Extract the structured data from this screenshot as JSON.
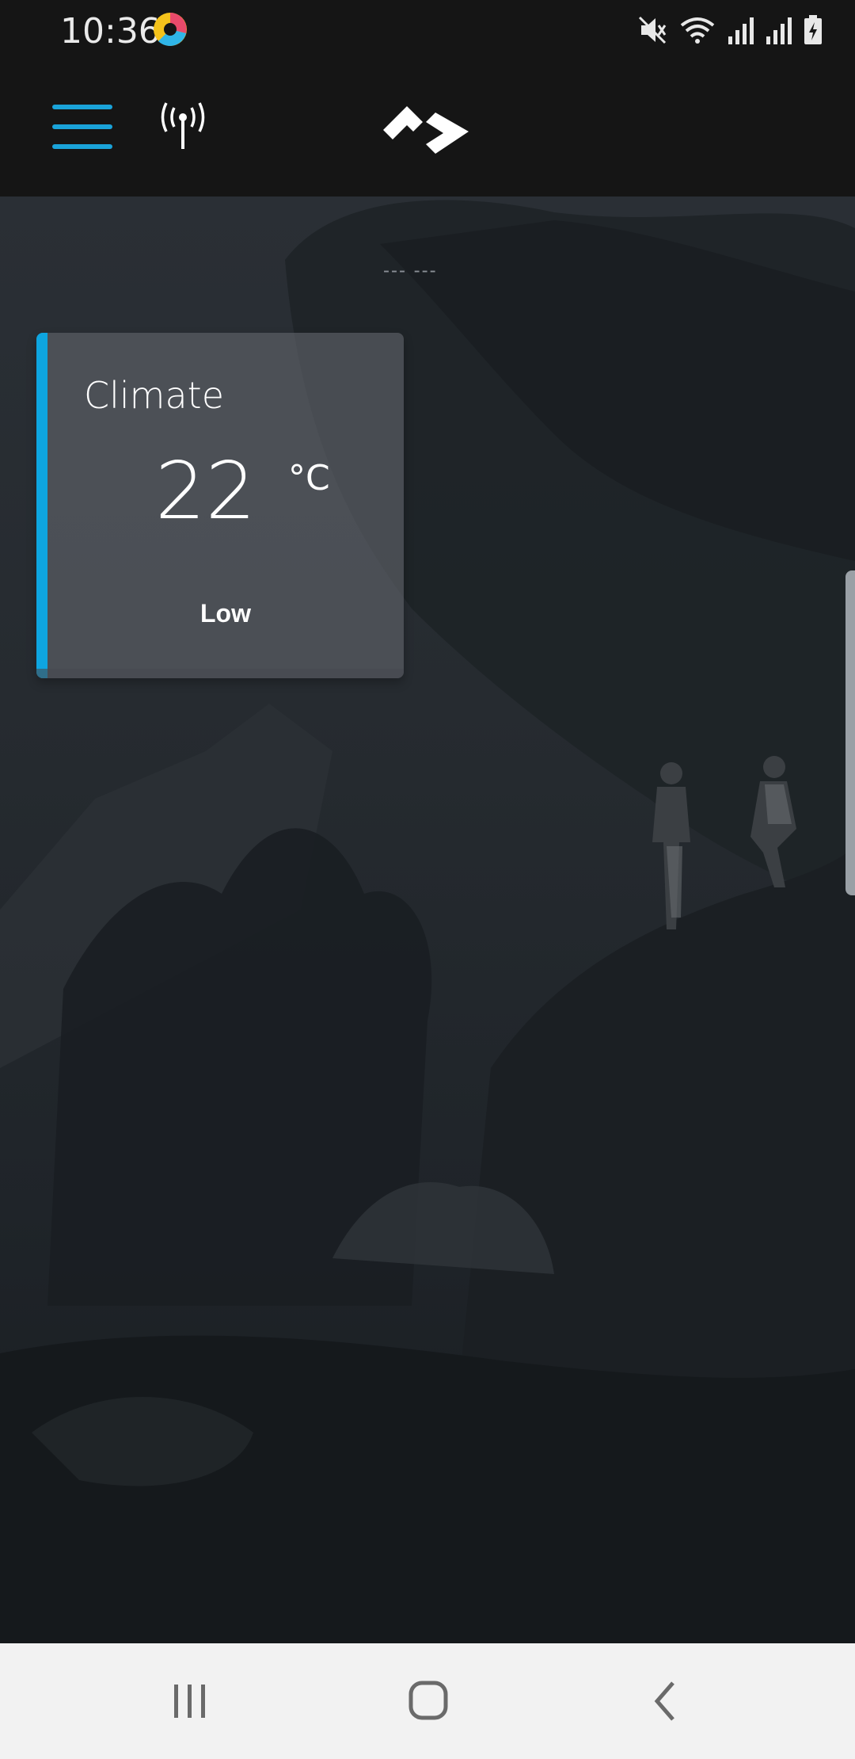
{
  "status_bar": {
    "time": "10:36",
    "icons": [
      "app-notification-icon",
      "mute-icon",
      "wifi-icon",
      "signal-icon",
      "signal-icon",
      "battery-charging-icon"
    ]
  },
  "header": {
    "menu_icon": "hamburger-menu-icon",
    "connection_icon": "antenna-icon",
    "logo": "brand-logo",
    "accent_color": "#1aa3d9"
  },
  "main": {
    "date_placeholder": "--- ---",
    "climate_card": {
      "title": "Climate",
      "temperature": "22",
      "unit": "°C",
      "fan_level": "Low",
      "accent_color": "#0ea5e0"
    }
  },
  "nav_bar": {
    "buttons": [
      "recent-apps-icon",
      "home-icon",
      "back-icon"
    ]
  }
}
